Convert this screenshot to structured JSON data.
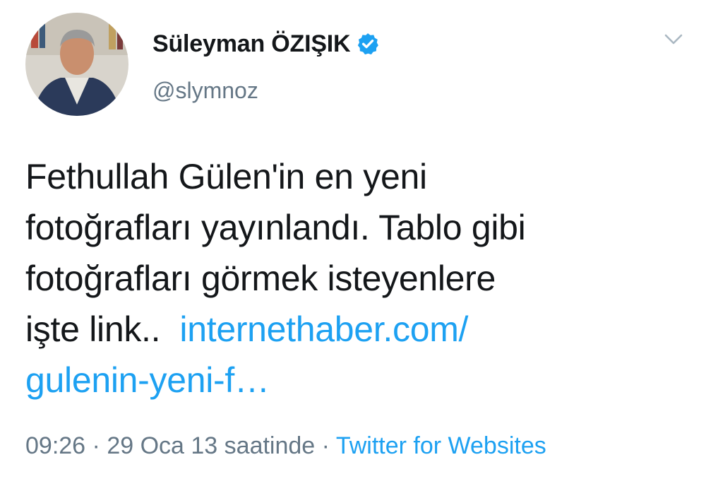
{
  "user": {
    "display_name": "Süleyman ÖZIŞIK",
    "handle": "@slymnoz",
    "verified": true
  },
  "tweet": {
    "lines": [
      "Fethullah Gülen'in en yeni",
      "fotoğrafları yayınlandı. Tablo gibi",
      "fotoğrafları görmek isteyenlere"
    ],
    "line4_text": "işte link..",
    "link_part1": "internethaber.com/",
    "link_part2": "gulenin-yeni-f…"
  },
  "meta": {
    "time": "09:26",
    "separator": "·",
    "date": "29 Oca 13 saatinde",
    "source": "Twitter for Websites"
  },
  "icons": {
    "verified": "verified-badge-icon",
    "caret": "chevron-down-icon"
  },
  "colors": {
    "link": "#1da1f2",
    "secondary_text": "#657786",
    "primary_text": "#14171a",
    "verified_badge": "#1da1f2"
  }
}
